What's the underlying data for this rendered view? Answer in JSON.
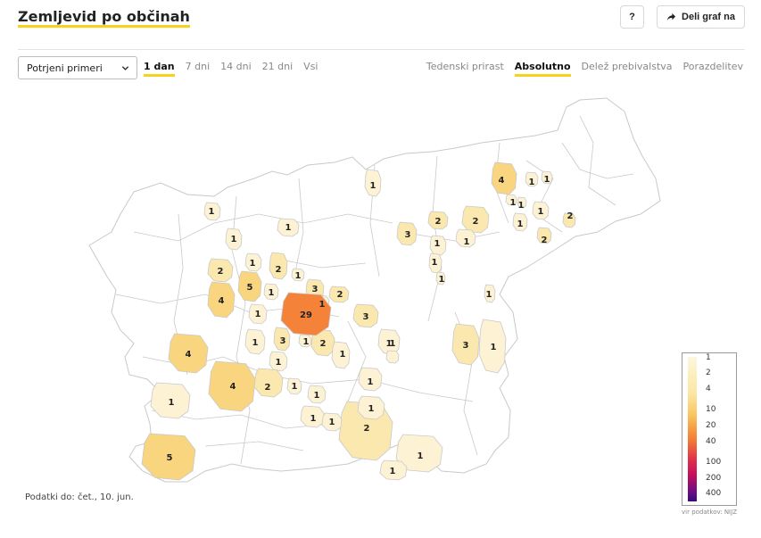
{
  "header": {
    "title": "Zemljevid po občinah",
    "help_label": "?",
    "share_label": "Deli graf na"
  },
  "controls": {
    "metric_select": "Potrjeni primeri",
    "period_tabs": [
      {
        "label": "1 dan",
        "active": true
      },
      {
        "label": "7 dni",
        "active": false
      },
      {
        "label": "14 dni",
        "active": false
      },
      {
        "label": "21 dni",
        "active": false
      },
      {
        "label": "Vsi",
        "active": false
      }
    ],
    "mode_tabs": [
      {
        "label": "Tedenski prirast",
        "active": false
      },
      {
        "label": "Absolutno",
        "active": true
      },
      {
        "label": "Delež prebivalstva",
        "active": false
      },
      {
        "label": "Porazdelitev",
        "active": false
      }
    ]
  },
  "map": {
    "municipality_values": [
      "4",
      "1",
      "1",
      "1",
      "1",
      "1",
      "1",
      "2",
      "2",
      "1",
      "1",
      "1",
      "1",
      "3",
      "2",
      "2",
      "1",
      "1",
      "1",
      "1",
      "1",
      "2",
      "2",
      "1",
      "3",
      "1",
      "2",
      "4",
      "5",
      "1",
      "1",
      "1",
      "3",
      "2",
      "1",
      "1",
      "29",
      "3",
      "1",
      "1",
      "1",
      "1",
      "2",
      "1",
      "3",
      "1",
      "4",
      "1",
      "4",
      "2",
      "1",
      "1",
      "1",
      "1",
      "1",
      "1",
      "1",
      "5"
    ],
    "colors": {
      "base": "#ffffff",
      "border": "#c9c9c9",
      "scale_1": "#fdf3d4",
      "scale_2": "#fbe8ae",
      "scale_4": "#f8d57e",
      "scale_29": "#f48239"
    }
  },
  "legend": {
    "ticks": [
      "1",
      "2",
      "4",
      "10",
      "20",
      "40",
      "100",
      "200",
      "400"
    ]
  },
  "footer": {
    "data_date": "Podatki do: čet., 10. jun.",
    "source": "vir podatkov: NIJZ"
  }
}
